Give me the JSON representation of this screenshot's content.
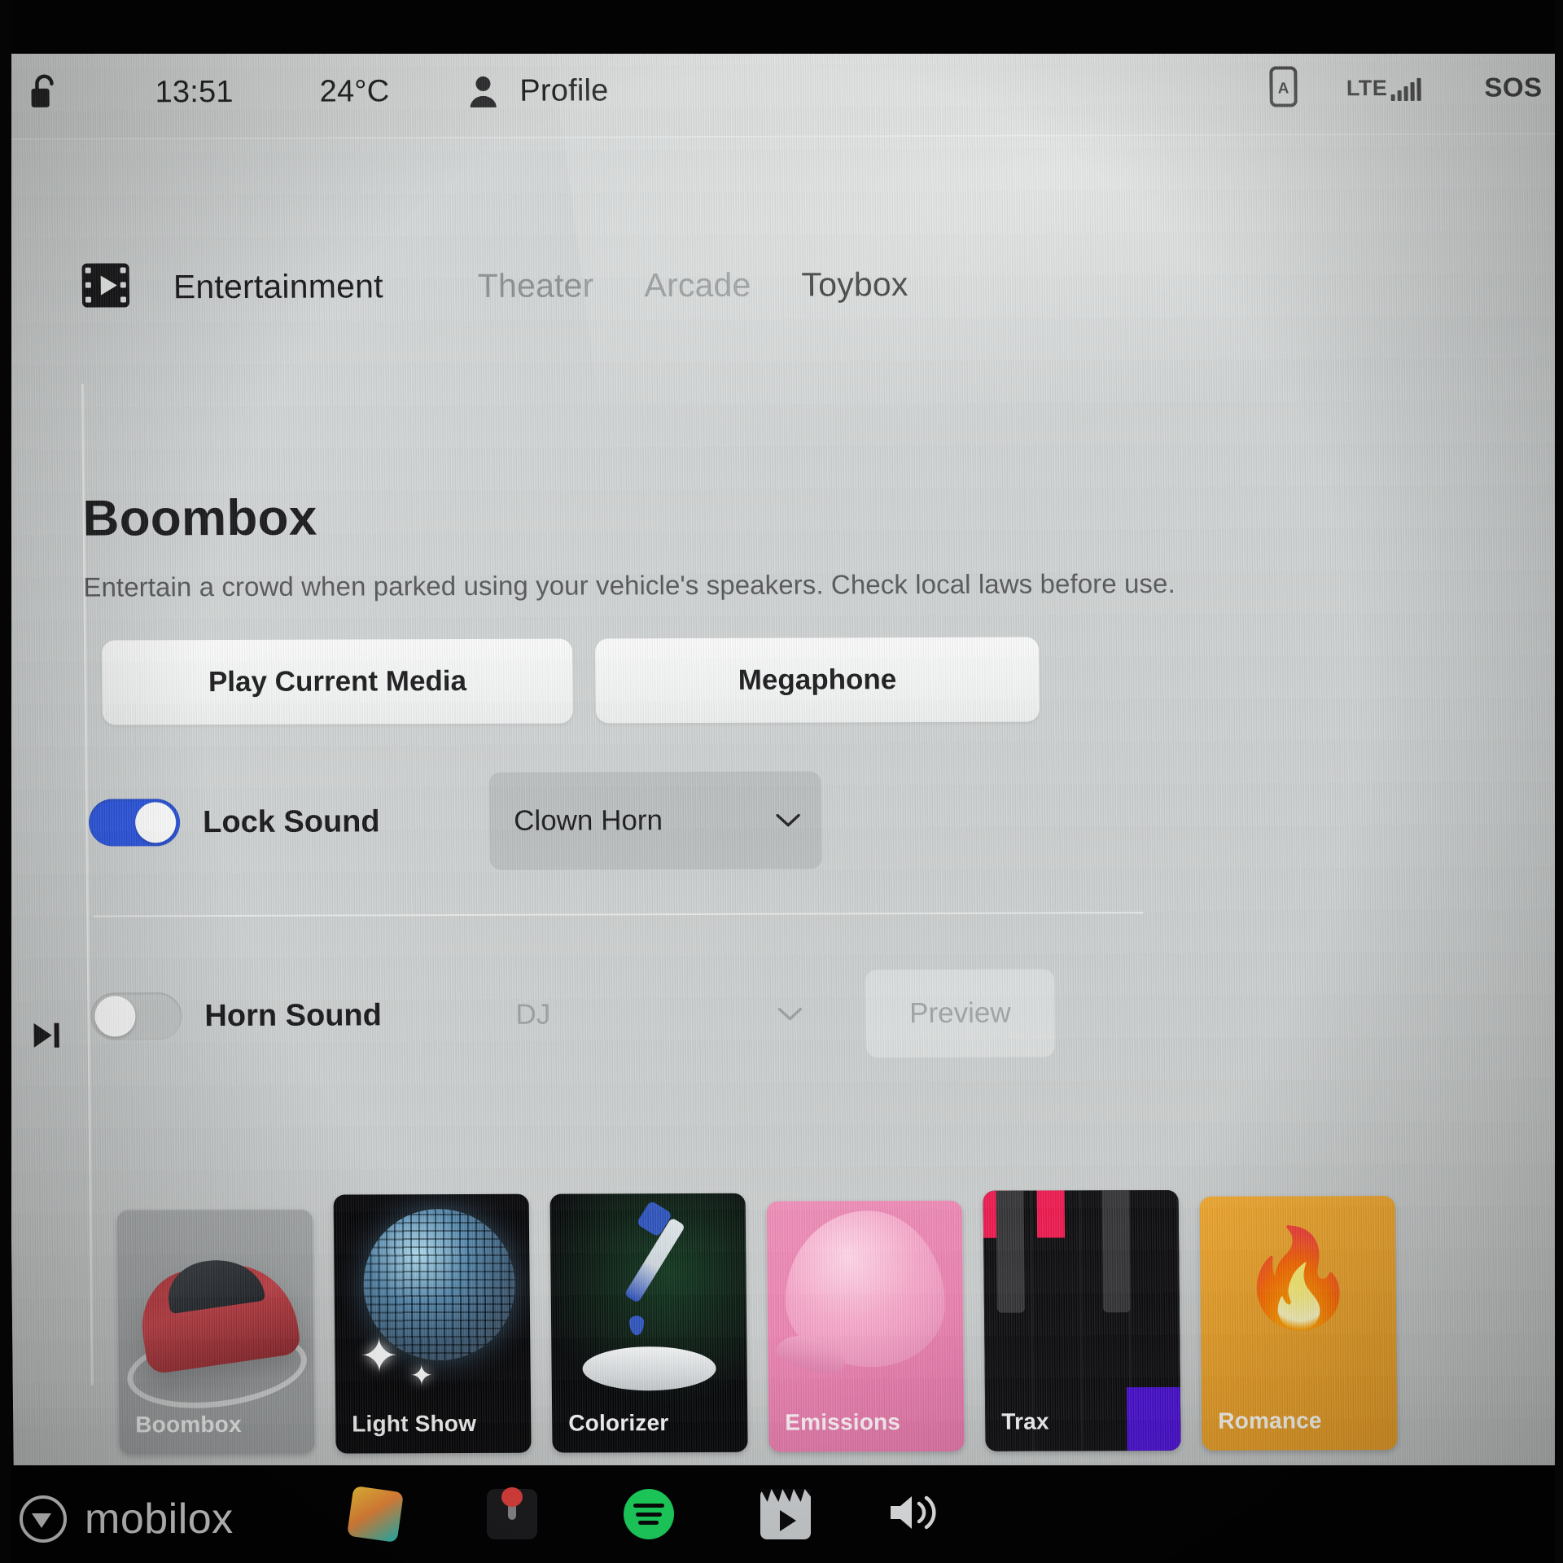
{
  "status_bar": {
    "lock_icon": "unlocked-padlock-icon",
    "time": "13:51",
    "temperature": "24°C",
    "profile_icon": "person-icon",
    "profile_label": "Profile",
    "phone_key_icon": "phone-key-icon",
    "network_label": "LTE",
    "signal_icon": "signal-bars-icon",
    "sos_label": "SOS"
  },
  "nav": {
    "app_icon": "film-strip-play-icon",
    "tabs": [
      {
        "label": "Entertainment",
        "state": "section-title"
      },
      {
        "label": "Theater",
        "state": "inactive"
      },
      {
        "label": "Arcade",
        "state": "inactive"
      },
      {
        "label": "Toybox",
        "state": "active"
      }
    ]
  },
  "panel": {
    "title": "Boombox",
    "description": "Entertain a crowd when parked using your vehicle's speakers. Check local laws before use.",
    "buttons": {
      "play_current_media": "Play Current Media",
      "megaphone": "Megaphone"
    },
    "settings": [
      {
        "label": "Lock Sound",
        "toggle_state": "on",
        "toggle_color": "#2B54DD",
        "select_value": "Clown Horn",
        "chevron_icon": "chevron-down-icon",
        "enabled": true
      },
      {
        "label": "Horn Sound",
        "toggle_state": "off",
        "toggle_color": "#C3C6C6",
        "select_value": "DJ",
        "chevron_icon": "chevron-down-icon",
        "preview_label": "Preview",
        "enabled": false
      }
    ]
  },
  "app_cards": [
    {
      "label": "Boombox",
      "art": "tesla-car-icon",
      "selected": true
    },
    {
      "label": "Light Show",
      "art": "disco-ball-icon",
      "selected": false
    },
    {
      "label": "Colorizer",
      "art": "eyedropper-icon",
      "selected": false
    },
    {
      "label": "Emissions",
      "art": "whoopee-cushion-icon",
      "selected": false
    },
    {
      "label": "Trax",
      "art": "piano-keys-icon",
      "selected": false
    },
    {
      "label": "Romance",
      "art": "campfire-icon",
      "selected": false
    }
  ],
  "taskbar": {
    "icons": [
      {
        "name": "toybox-icon"
      },
      {
        "name": "arcade-joystick-icon"
      },
      {
        "name": "spotify-icon"
      },
      {
        "name": "theater-clapperboard-icon"
      }
    ],
    "volume_icon": "speaker-volume-icon",
    "skip_icon": "skip-next-icon"
  },
  "watermark": {
    "text": "mobilox",
    "icon": "play-circle-icon"
  }
}
